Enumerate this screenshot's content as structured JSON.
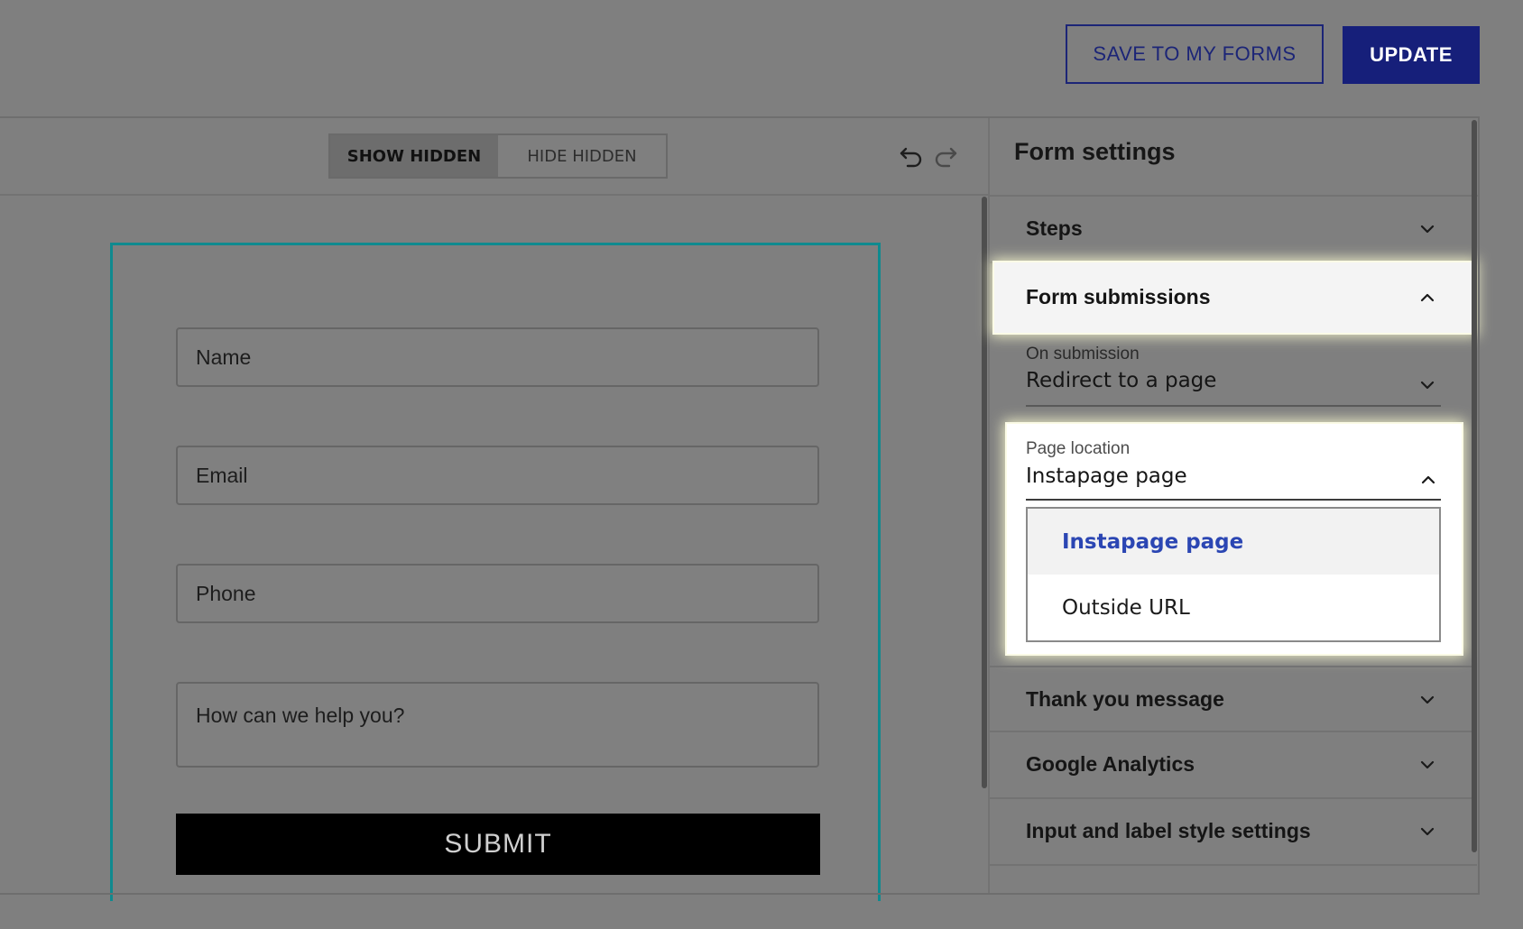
{
  "header": {
    "save_label": "SAVE TO MY FORMS",
    "update_label": "UPDATE"
  },
  "toolbar": {
    "show_hidden": "SHOW HIDDEN",
    "hide_hidden": "HIDE HIDDEN",
    "active_toggle": "SHOW HIDDEN",
    "undo_icon": "undo-icon",
    "redo_icon": "redo-icon"
  },
  "form": {
    "fields": [
      {
        "placeholder": "Name"
      },
      {
        "placeholder": "Email"
      },
      {
        "placeholder": "Phone"
      },
      {
        "placeholder": "How can we help you?"
      }
    ],
    "submit_label": "SUBMIT"
  },
  "panel": {
    "title": "Form settings",
    "sections": [
      {
        "label": "Steps",
        "expanded": false
      },
      {
        "label": "Form submissions",
        "expanded": true
      },
      {
        "label": "Thank you message",
        "expanded": false
      },
      {
        "label": "Google Analytics",
        "expanded": false
      },
      {
        "label": "Input and label style settings",
        "expanded": false
      }
    ],
    "on_submission": {
      "label": "On submission",
      "value": "Redirect to a page"
    },
    "page_location": {
      "label": "Page location",
      "value": "Instapage page",
      "options": [
        "Instapage page",
        "Outside URL"
      ],
      "selected": "Instapage page"
    }
  },
  "colors": {
    "overlay": "#7f7f7f",
    "accent": "#161f7a",
    "canvas_frame": "#0f8a8f",
    "selected_option": "#2b46b3"
  }
}
